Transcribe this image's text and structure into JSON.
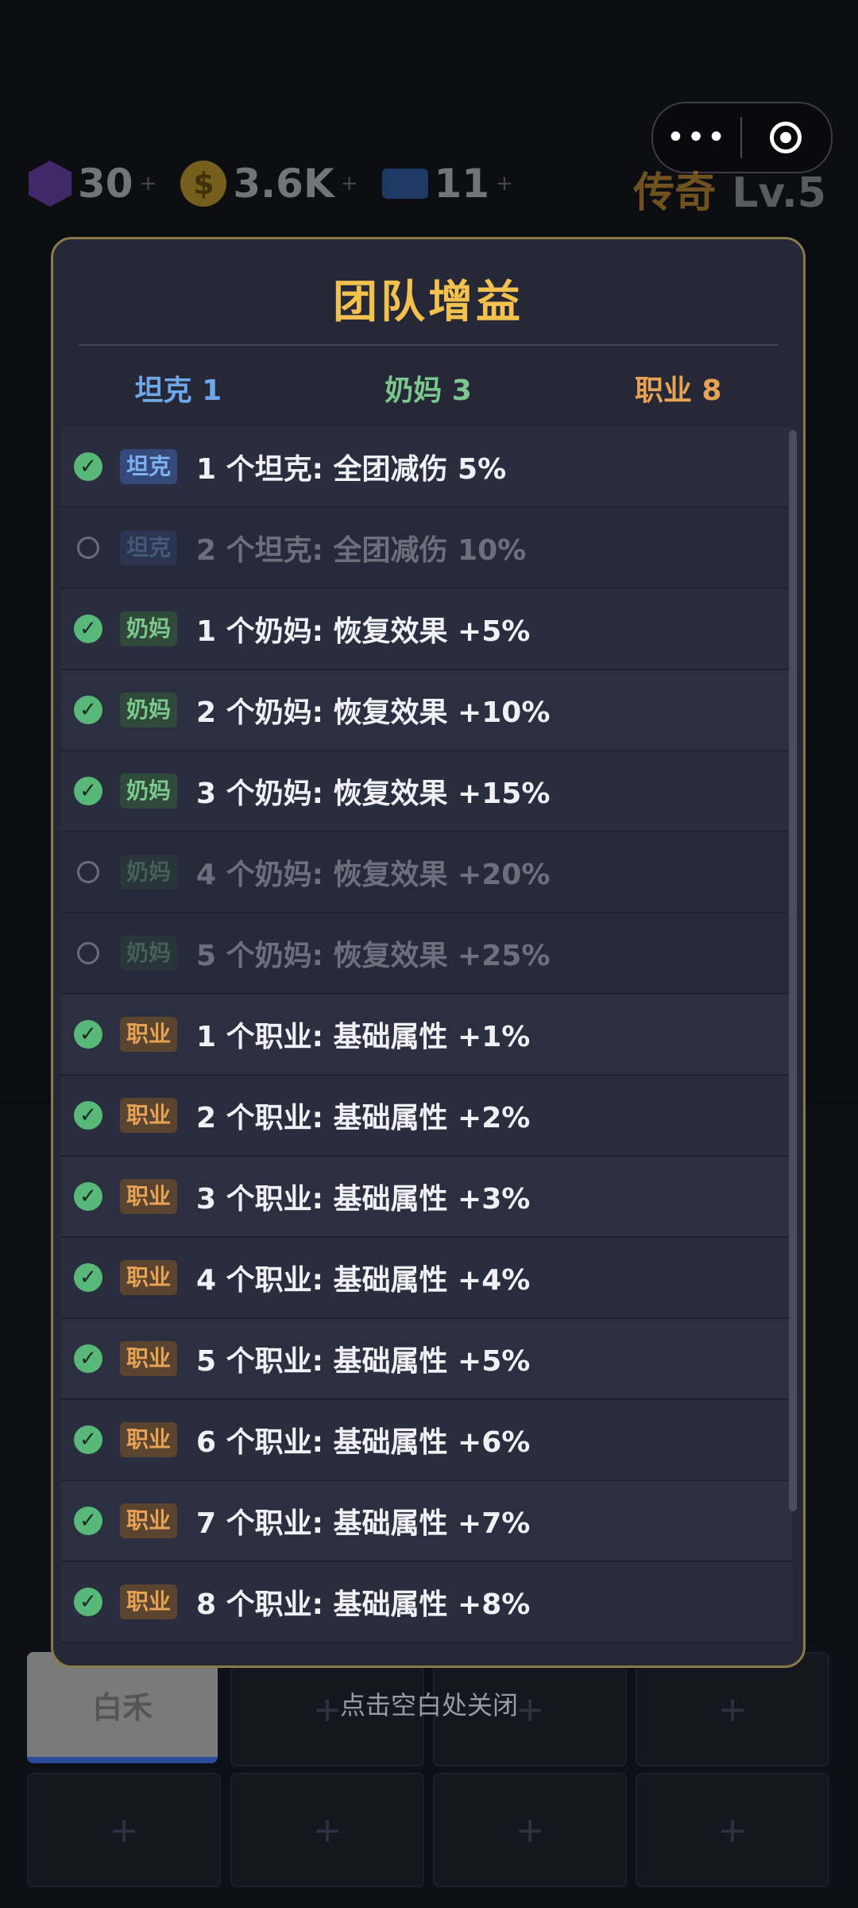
{
  "status": {
    "resources": [
      {
        "icon": "gem-icon",
        "value": "30",
        "plus": "+"
      },
      {
        "icon": "coin-icon",
        "value": "3.6K",
        "plus": "+"
      },
      {
        "icon": "ticket-icon",
        "value": "11",
        "plus": "+"
      }
    ],
    "rank_name": "传奇",
    "rank_level": "Lv.5",
    "capsule_more": "•••"
  },
  "background": {
    "slot_label": "白禾",
    "close_hint": "点击空白处关闭",
    "plus": "+"
  },
  "modal": {
    "title": "团队增益",
    "tabs": [
      {
        "label": "坦克 1"
      },
      {
        "label": "奶妈 3"
      },
      {
        "label": "职业 8"
      }
    ],
    "rows": [
      {
        "active": true,
        "tag": "坦克",
        "type": "tank",
        "text": "1 个坦克: 全团减伤 5%"
      },
      {
        "active": false,
        "tag": "坦克",
        "type": "tank",
        "text": "2 个坦克: 全团减伤 10%"
      },
      {
        "active": true,
        "tag": "奶妈",
        "type": "heal",
        "text": "1 个奶妈: 恢复效果 +5%"
      },
      {
        "active": true,
        "tag": "奶妈",
        "type": "heal",
        "text": "2 个奶妈: 恢复效果 +10%"
      },
      {
        "active": true,
        "tag": "奶妈",
        "type": "heal",
        "text": "3 个奶妈: 恢复效果 +15%"
      },
      {
        "active": false,
        "tag": "奶妈",
        "type": "heal",
        "text": "4 个奶妈: 恢复效果 +20%"
      },
      {
        "active": false,
        "tag": "奶妈",
        "type": "heal",
        "text": "5 个奶妈: 恢复效果 +25%"
      },
      {
        "active": true,
        "tag": "职业",
        "type": "job",
        "text": "1 个职业: 基础属性 +1%"
      },
      {
        "active": true,
        "tag": "职业",
        "type": "job",
        "text": "2 个职业: 基础属性 +2%"
      },
      {
        "active": true,
        "tag": "职业",
        "type": "job",
        "text": "3 个职业: 基础属性 +3%"
      },
      {
        "active": true,
        "tag": "职业",
        "type": "job",
        "text": "4 个职业: 基础属性 +4%"
      },
      {
        "active": true,
        "tag": "职业",
        "type": "job",
        "text": "5 个职业: 基础属性 +5%"
      },
      {
        "active": true,
        "tag": "职业",
        "type": "job",
        "text": "6 个职业: 基础属性 +6%"
      },
      {
        "active": true,
        "tag": "职业",
        "type": "job",
        "text": "7 个职业: 基础属性 +7%"
      },
      {
        "active": true,
        "tag": "职业",
        "type": "job",
        "text": "8 个职业: 基础属性 +8%"
      }
    ]
  },
  "colors": {
    "title": "#f2c14e",
    "tank": "#6fa8e8",
    "heal": "#7cc88c",
    "job": "#e6a355",
    "check": "#58b87a"
  }
}
